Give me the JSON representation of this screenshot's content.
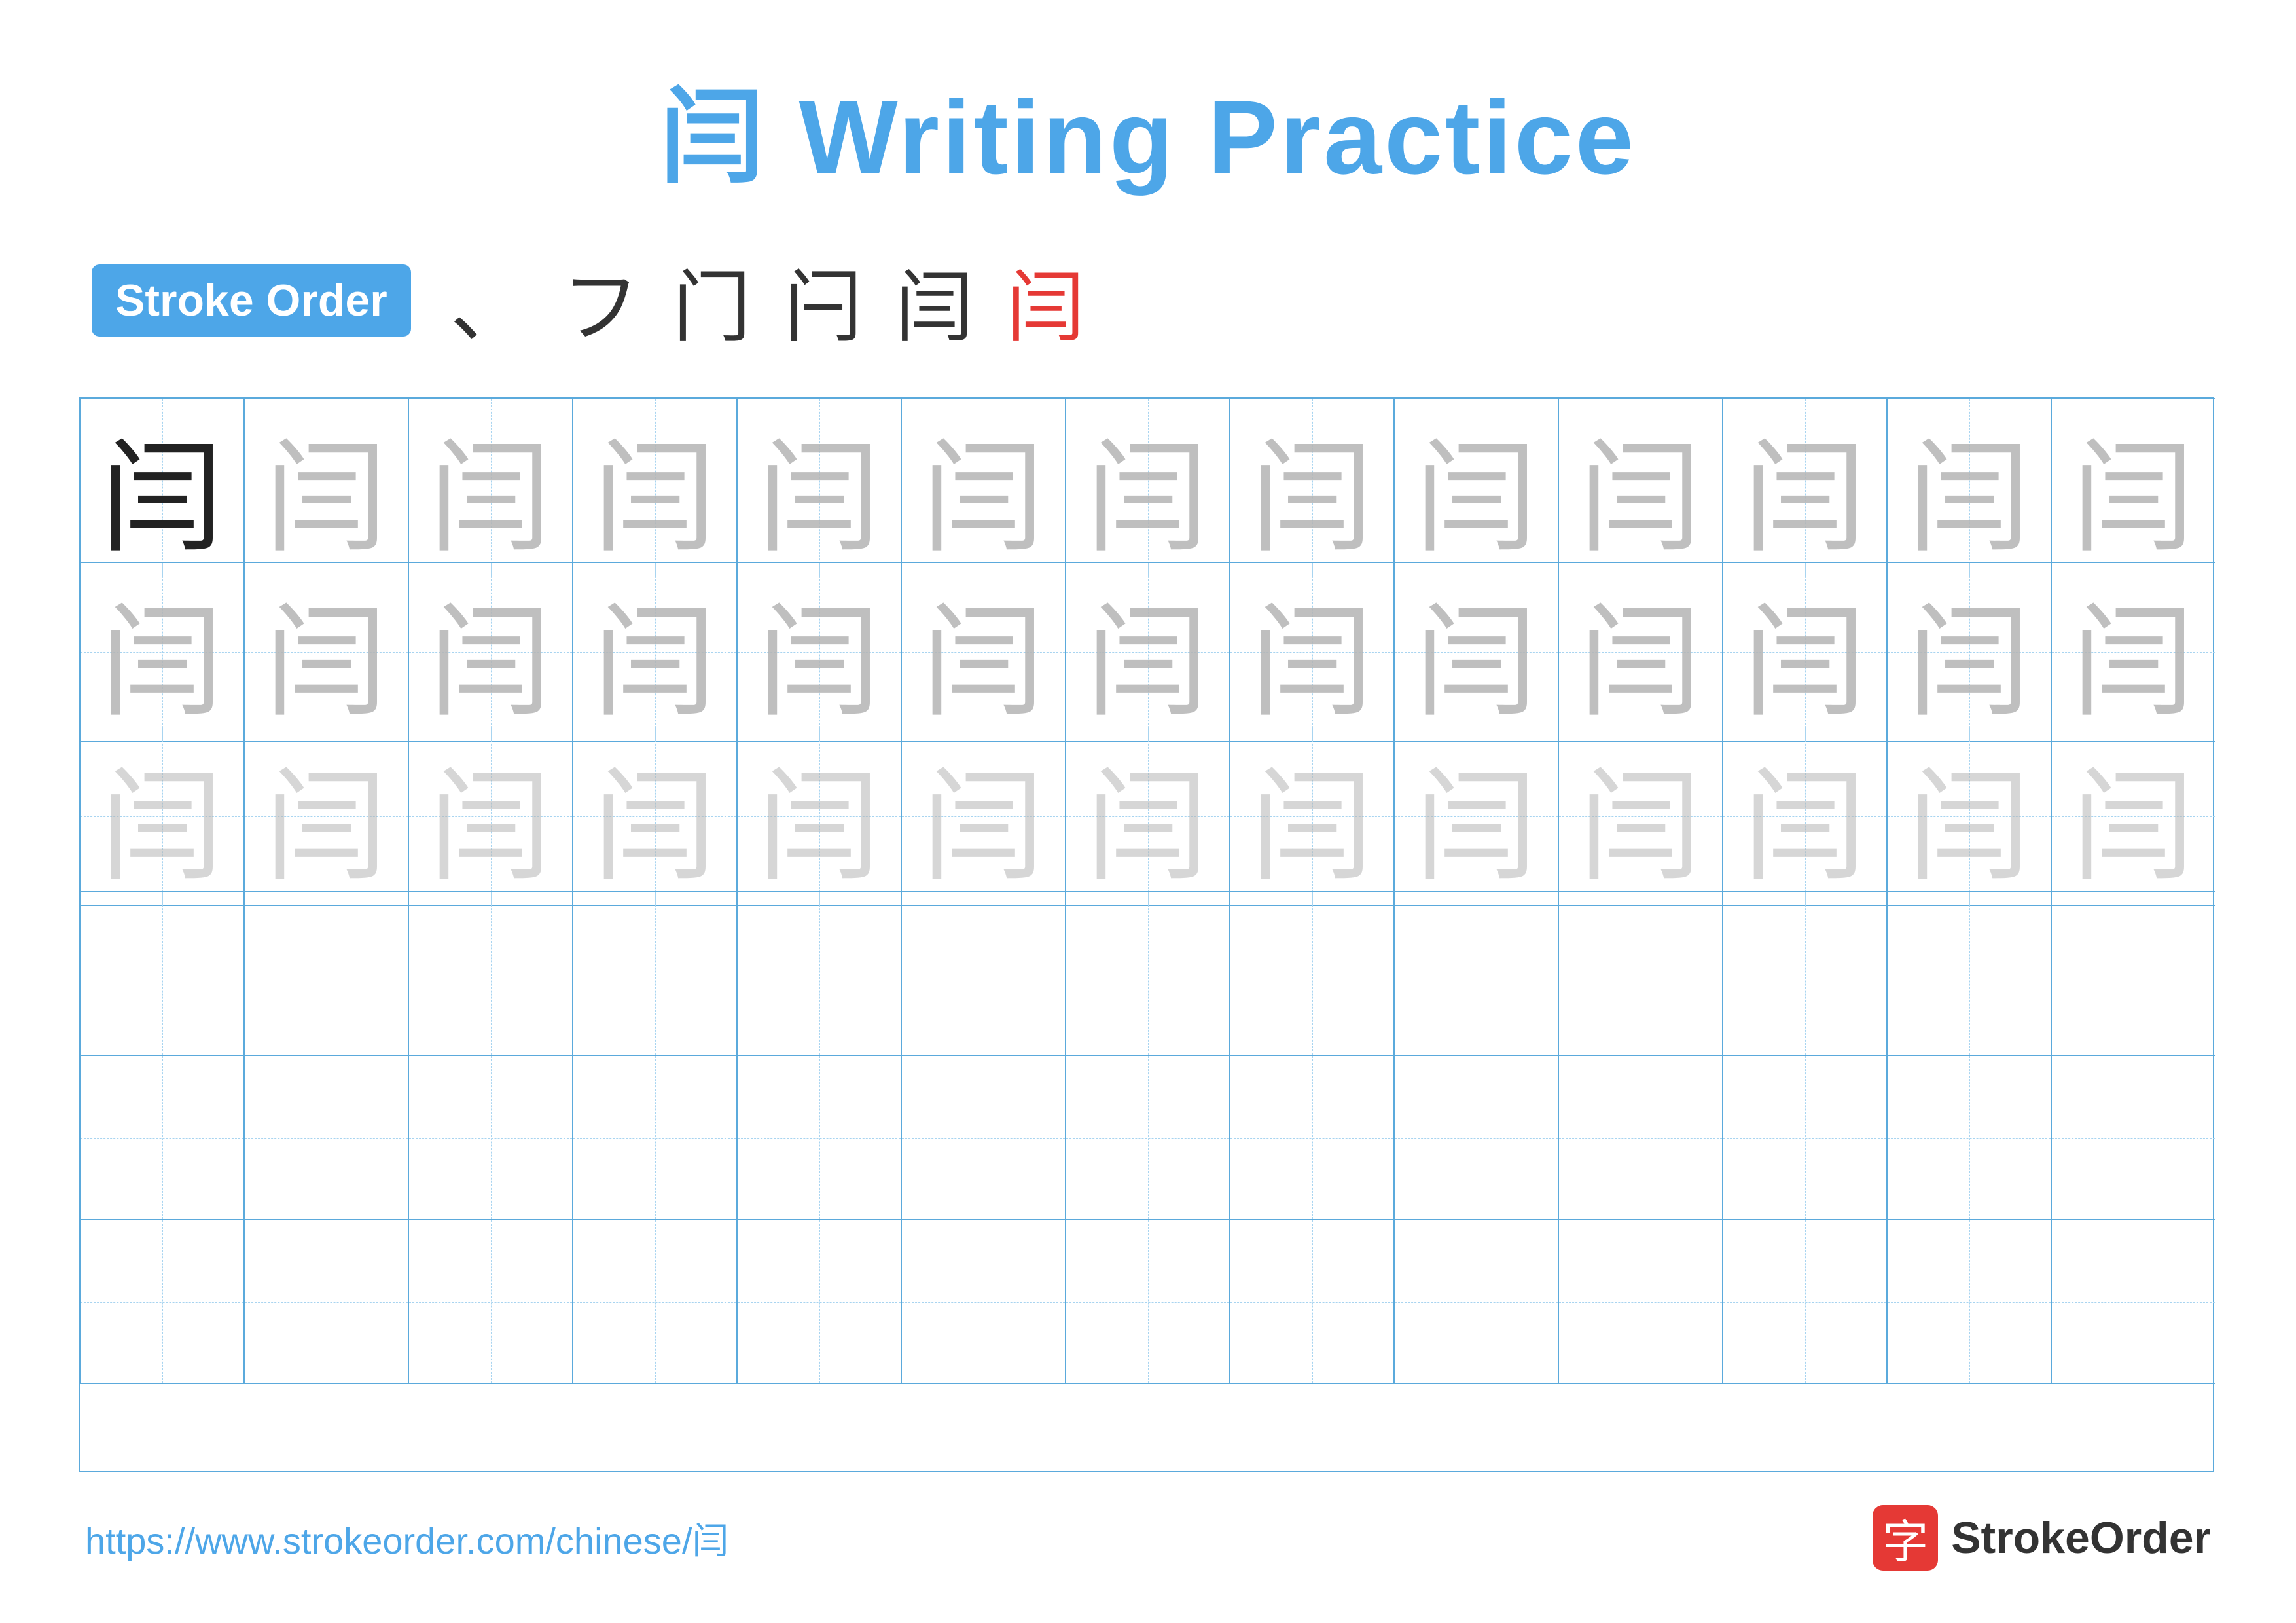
{
  "title": "闫 Writing Practice",
  "stroke_order_badge": "Stroke Order",
  "stroke_sequence": [
    "、",
    "フ",
    "门",
    "闩",
    "闫",
    "闫"
  ],
  "stroke_sequence_colors": [
    "black",
    "black",
    "black",
    "black",
    "black",
    "black"
  ],
  "character": "闫",
  "footer_url": "https://www.strokeorder.com/chinese/闫",
  "logo_char": "字",
  "logo_name": "StrokeOrder",
  "grid_cols": 13,
  "grid_rows": 6,
  "row_opacities": [
    "solid",
    "faint-1",
    "faint-2",
    "empty",
    "empty",
    "empty"
  ]
}
